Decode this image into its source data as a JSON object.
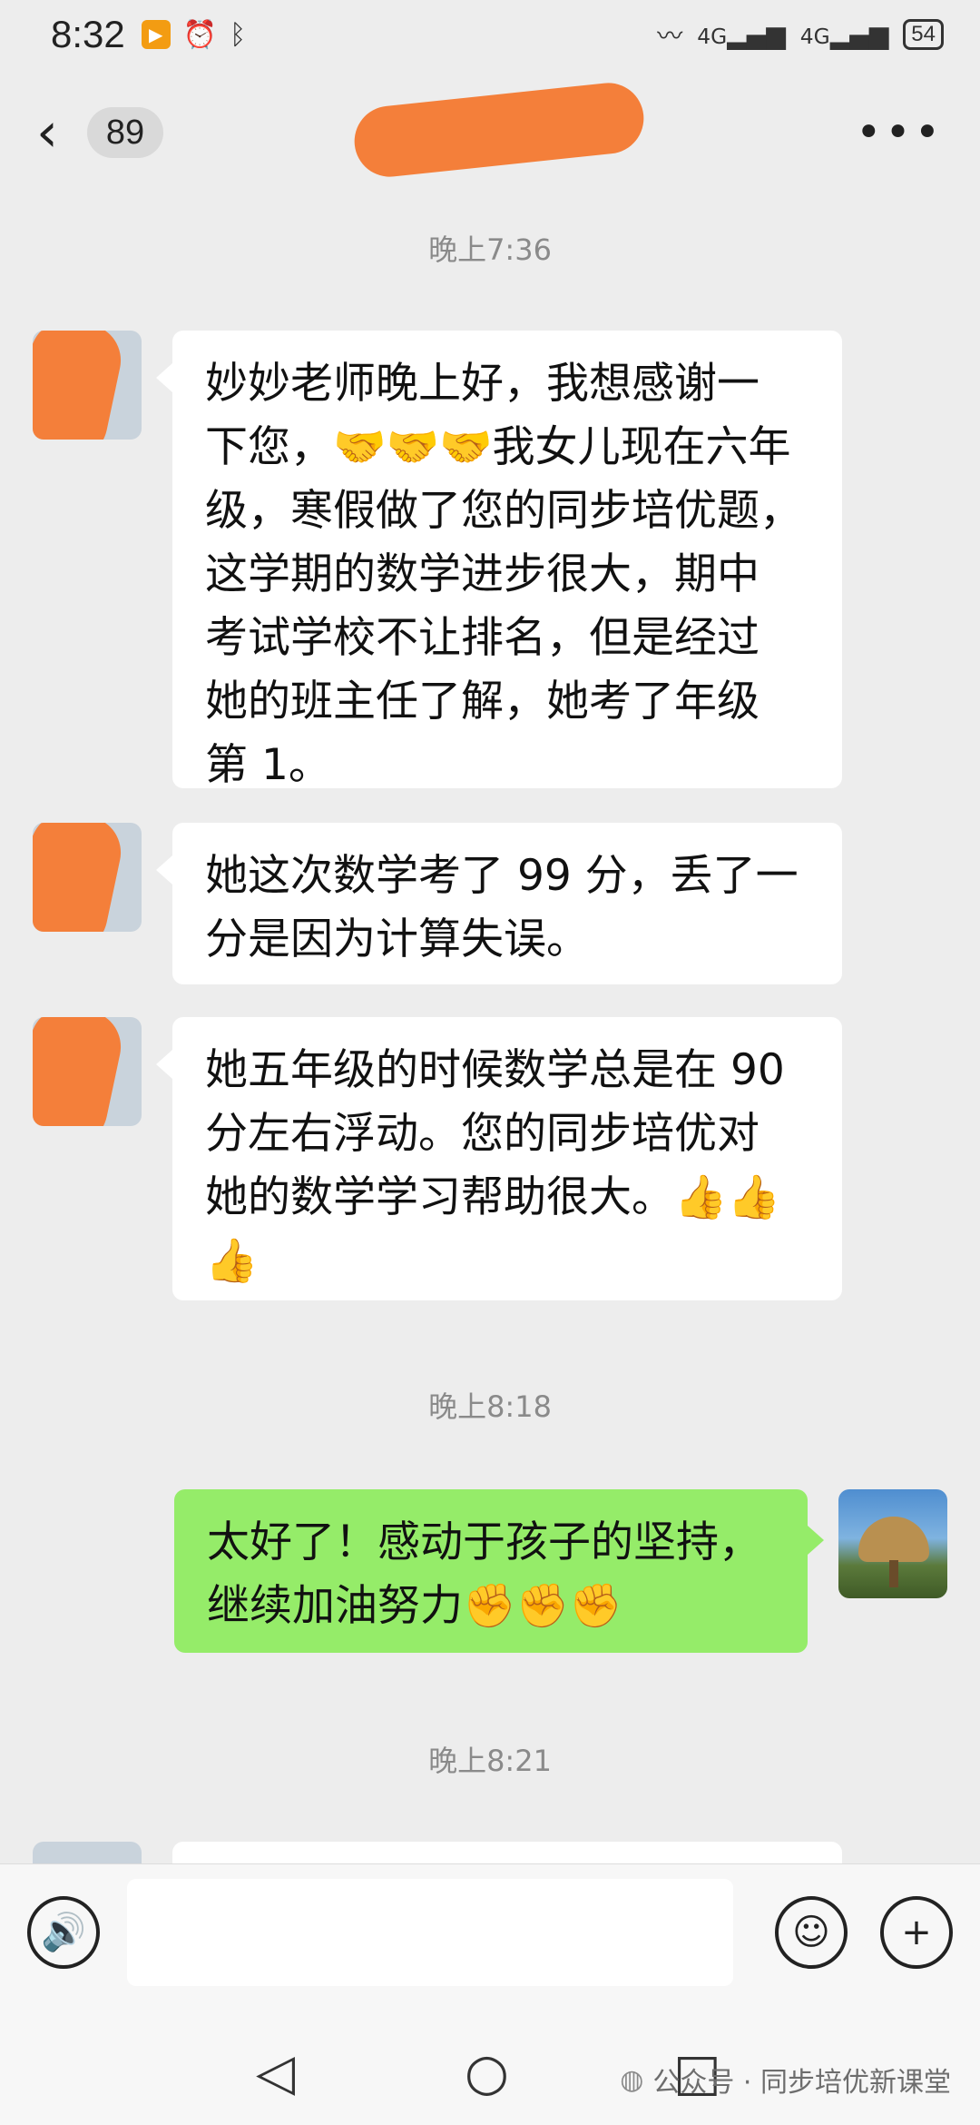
{
  "status_bar": {
    "time": "8:32",
    "network": "4G",
    "battery": "54"
  },
  "header": {
    "unread_count": "89"
  },
  "messages": [
    {
      "timestamp": "晚上7:36",
      "from": "other",
      "lines": [
        "妙妙老师晚上好，我想感谢一",
        "下您，🤝🤝🤝我女儿现在六年",
        "级，寒假做了您的同步培优题，",
        "这学期的数学进步很大，期中",
        "考试学校不让排名，但是经过",
        "她的班主任了解，她考了年级",
        "第 1。"
      ]
    },
    {
      "from": "other",
      "lines": [
        "她这次数学考了 99 分，丢了一",
        "分是因为计算失误。"
      ]
    },
    {
      "from": "other",
      "lines": [
        "她五年级的时候数学总是在 90",
        "分左右浮动。您的同步培优对",
        "她的数学学习帮助很大。👍👍",
        "👍"
      ]
    },
    {
      "timestamp": "晚上8:18",
      "from": "me",
      "lines": [
        "太好了！感动于孩子的坚持，",
        "继续加油努力✊✊✊"
      ]
    },
    {
      "timestamp": "晚上8:21"
    }
  ],
  "watermark": "公众号 · 同步培优新课堂"
}
